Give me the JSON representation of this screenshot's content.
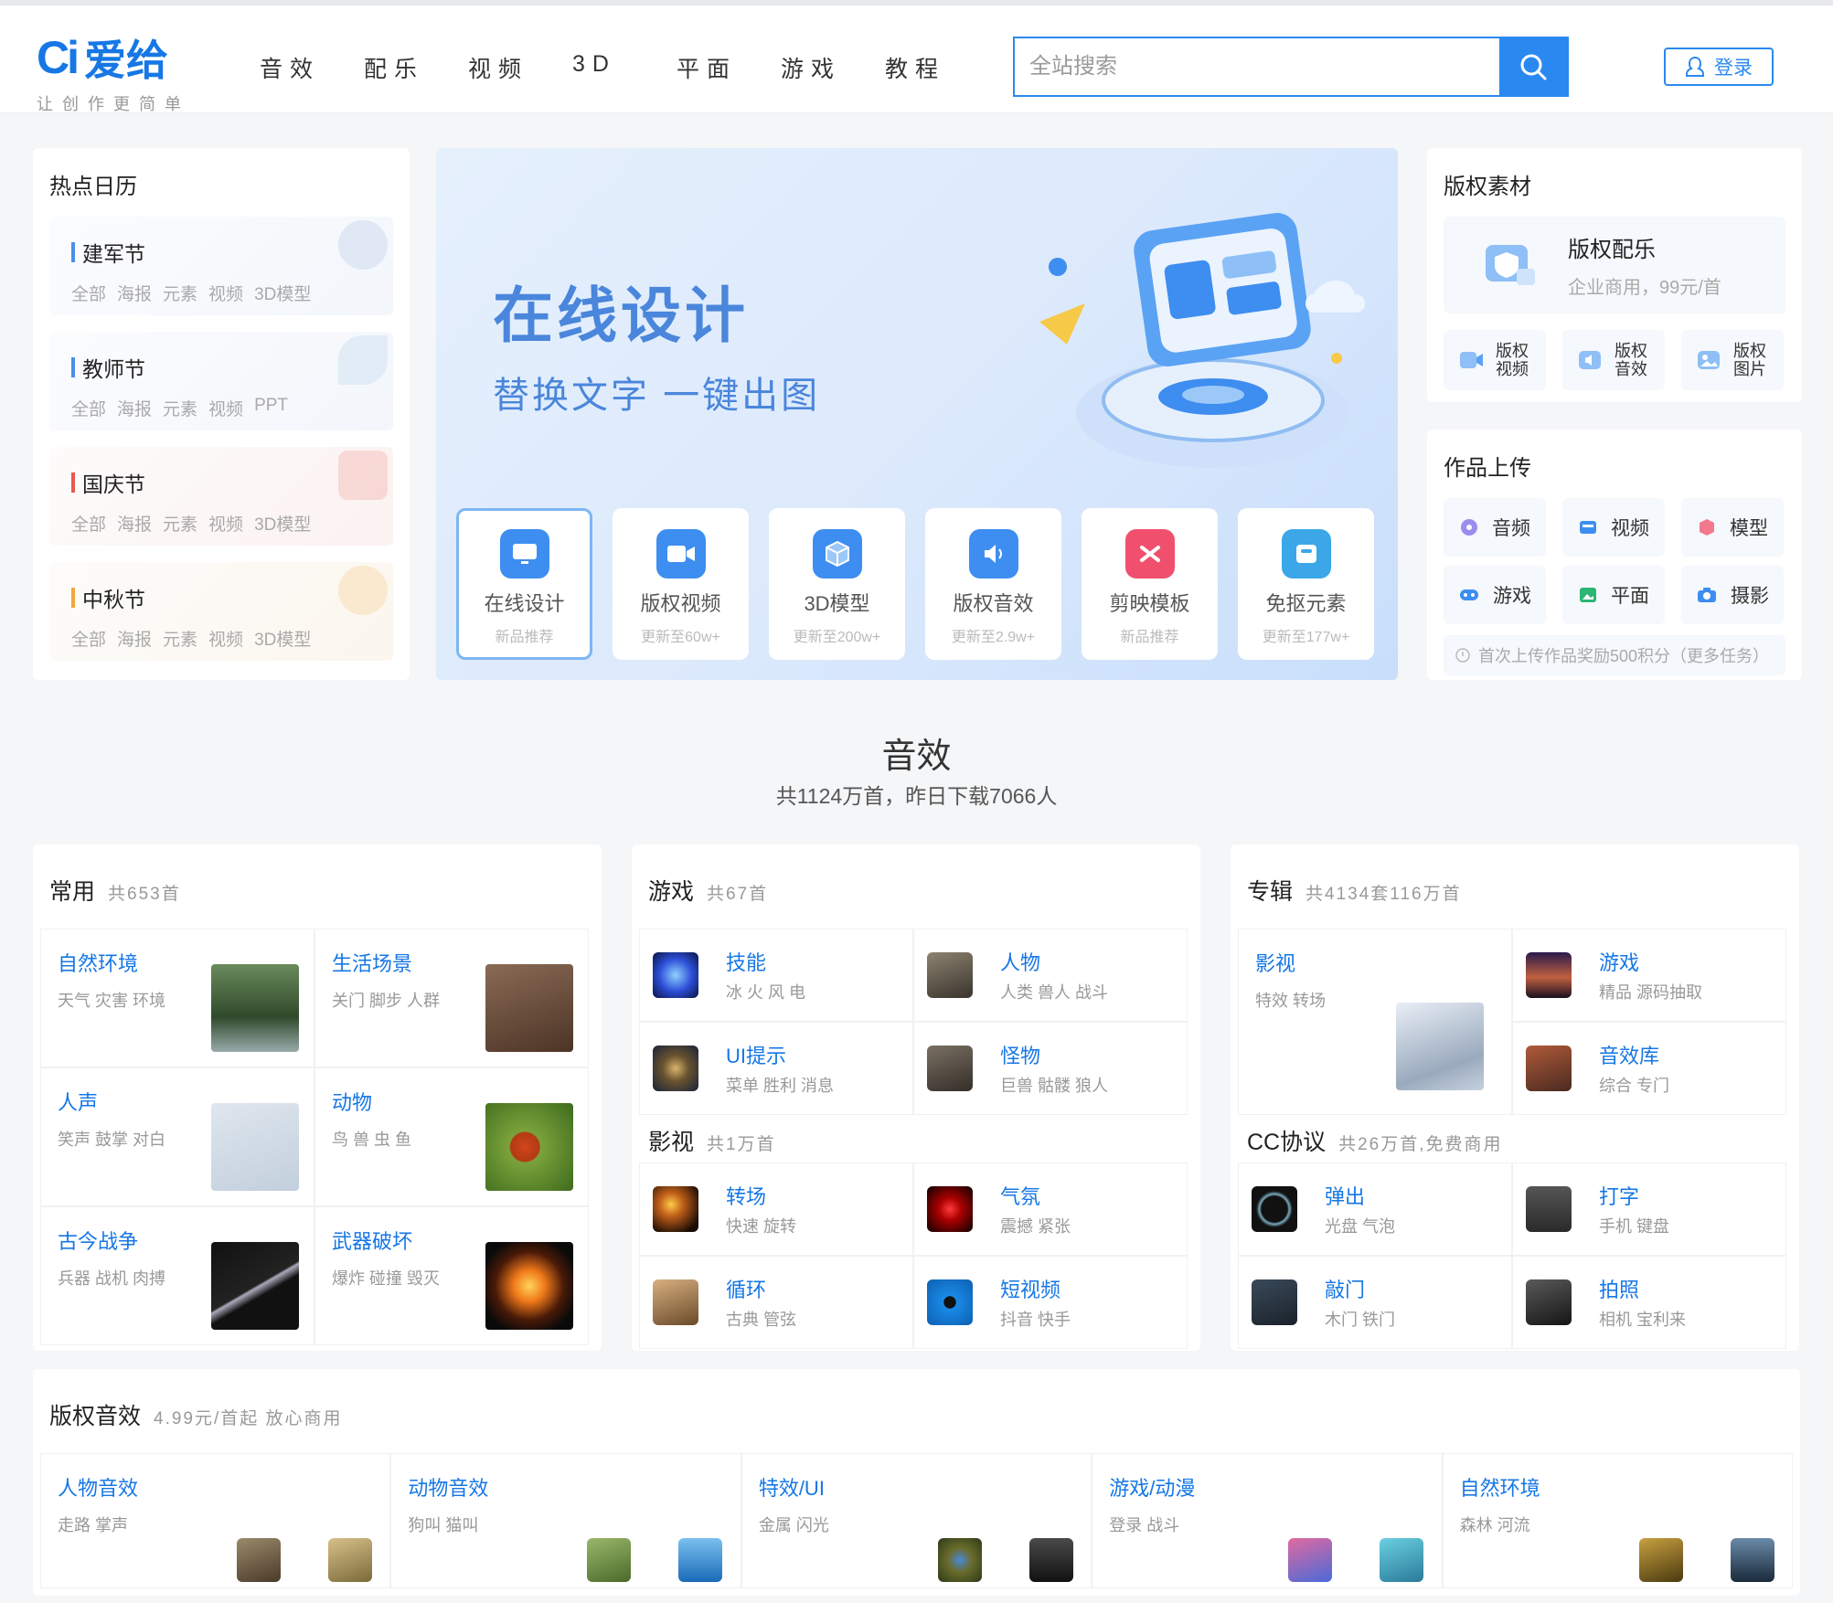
{
  "header": {
    "logo_mark": "Ci",
    "logo_text": "爱给",
    "logo_sub": "让创作更简单",
    "nav": [
      "音效",
      "配乐",
      "视频",
      "3D",
      "平面",
      "游戏",
      "教程"
    ],
    "search_placeholder": "全站搜索",
    "login_label": "登录"
  },
  "hot_calendar": {
    "title": "热点日历",
    "items": [
      {
        "name": "建军节",
        "color": "#4c8fe6",
        "tags": [
          "全部",
          "海报",
          "元素",
          "视频",
          "3D模型"
        ]
      },
      {
        "name": "教师节",
        "color": "#4c8fe6",
        "tags": [
          "全部",
          "海报",
          "元素",
          "视频",
          "PPT"
        ]
      },
      {
        "name": "国庆节",
        "color": "#e85a4f",
        "tags": [
          "全部",
          "海报",
          "元素",
          "视频",
          "3D模型"
        ]
      },
      {
        "name": "中秋节",
        "color": "#f2a73b",
        "tags": [
          "全部",
          "海报",
          "元素",
          "视频",
          "3D模型"
        ]
      }
    ]
  },
  "banner": {
    "title": "在线设计",
    "subtitle": "替换文字 一键出图",
    "tiles": [
      {
        "label": "在线设计",
        "sub": "新品推荐",
        "color": "#3d8ef0"
      },
      {
        "label": "版权视频",
        "sub": "更新至60w+",
        "color": "#3d8ef0"
      },
      {
        "label": "3D模型",
        "sub": "更新至200w+",
        "color": "#3d8ef0"
      },
      {
        "label": "版权音效",
        "sub": "更新至2.9w+",
        "color": "#3d8ef0"
      },
      {
        "label": "剪映模板",
        "sub": "新品推荐",
        "color": "#f0506e"
      },
      {
        "label": "免抠元素",
        "sub": "更新至177w+",
        "color": "#3ba7e8"
      }
    ]
  },
  "copyright_assets": {
    "title": "版权素材",
    "main_title": "版权配乐",
    "main_sub": "企业商用，99元/首",
    "buttons": [
      "版权视频",
      "版权音效",
      "版权图片"
    ]
  },
  "upload": {
    "title": "作品上传",
    "buttons": [
      "音频",
      "视频",
      "模型",
      "游戏",
      "平面",
      "摄影"
    ],
    "note": "首次上传作品奖励500积分（更多任务）"
  },
  "sound": {
    "title": "音效",
    "subtitle": "共1124万首，昨日下载7066人"
  },
  "panel_common": {
    "name": "常用",
    "count": "共653首",
    "cells": [
      {
        "name": "自然环境",
        "tags": "天气 灾害 环境"
      },
      {
        "name": "生活场景",
        "tags": "关门 脚步 人群"
      },
      {
        "name": "人声",
        "tags": "笑声 鼓掌 对白"
      },
      {
        "name": "动物",
        "tags": "鸟 兽 虫 鱼"
      },
      {
        "name": "古今战争",
        "tags": "兵器 战机 肉搏"
      },
      {
        "name": "武器破坏",
        "tags": "爆炸 碰撞 毁灭"
      }
    ]
  },
  "panel_game": {
    "name": "游戏",
    "count": "共67首",
    "cells": [
      {
        "name": "技能",
        "tags": "冰 火 风 电"
      },
      {
        "name": "人物",
        "tags": "人类 兽人 战斗"
      },
      {
        "name": "UI提示",
        "tags": "菜单 胜利 消息"
      },
      {
        "name": "怪物",
        "tags": "巨兽 骷髅 狼人"
      }
    ],
    "sub_name": "影视",
    "sub_count": "共1万首",
    "sub_cells": [
      {
        "name": "转场",
        "tags": "快速 旋转"
      },
      {
        "name": "气氛",
        "tags": "震撼 紧张"
      },
      {
        "name": "循环",
        "tags": "古典 管弦"
      },
      {
        "name": "短视频",
        "tags": "抖音 快手"
      }
    ]
  },
  "panel_album": {
    "name": "专辑",
    "count": "共4134套116万首",
    "tall": {
      "name": "影视",
      "tags": "特效 转场"
    },
    "cells": [
      {
        "name": "游戏",
        "tags": "精品 源码抽取"
      },
      {
        "name": "音效库",
        "tags": "综合 专门"
      }
    ],
    "sub_name": "CC协议",
    "sub_count": "共26万首,免费商用",
    "sub_cells": [
      {
        "name": "弹出",
        "tags": "光盘 气泡"
      },
      {
        "name": "打字",
        "tags": "手机 键盘"
      },
      {
        "name": "敲门",
        "tags": "木门 铁门"
      },
      {
        "name": "拍照",
        "tags": "相机 宝利来"
      }
    ]
  },
  "copyright_sound": {
    "name": "版权音效",
    "count": "4.99元/首起 放心商用",
    "cells": [
      {
        "name": "人物音效",
        "tags": "走路 掌声"
      },
      {
        "name": "动物音效",
        "tags": "狗叫 猫叫"
      },
      {
        "name": "特效/UI",
        "tags": "金属 闪光"
      },
      {
        "name": "游戏/动漫",
        "tags": "登录 战斗"
      },
      {
        "name": "自然环境",
        "tags": "森林 河流"
      }
    ]
  }
}
